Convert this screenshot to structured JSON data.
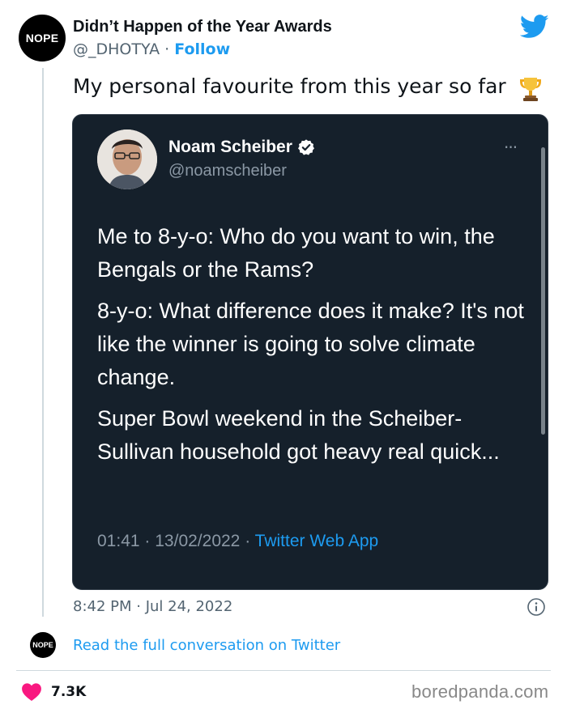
{
  "tweet": {
    "author_avatar_text": "NOPE",
    "author_name": "Didn’t Happen of the Year Awards",
    "handle": "@_DHOTYA",
    "separator": "·",
    "follow_label": "Follow",
    "text": "My personal favourite from this year so far",
    "timestamp": "8:42 PM · Jul 24, 2022",
    "read_conversation_label": "Read the full conversation on Twitter",
    "like_count": "7.3K"
  },
  "embedded": {
    "name": "Noam Scheiber",
    "handle": "@noamscheiber",
    "more": "···",
    "paragraphs": [
      "Me to 8-y-o: Who do you want to win, the Bengals or the Rams?",
      "8-y-o: What difference does it make? It's not like the winner is going to solve climate change.",
      "Super Bowl weekend in the Scheiber-Sullivan household got heavy real quick..."
    ],
    "time": "01:41",
    "date": "13/02/2022",
    "app": "Twitter Web App"
  },
  "watermark": "boredpanda.com",
  "icons": {
    "twitter": "twitter-bird-icon",
    "trophy": "trophy-icon",
    "verified": "verified-badge-icon",
    "info": "info-icon",
    "heart": "heart-icon"
  },
  "colors": {
    "accent": "#1d9bf0",
    "heart": "#f91880",
    "embed_bg": "#15202b",
    "muted": "#536471"
  }
}
